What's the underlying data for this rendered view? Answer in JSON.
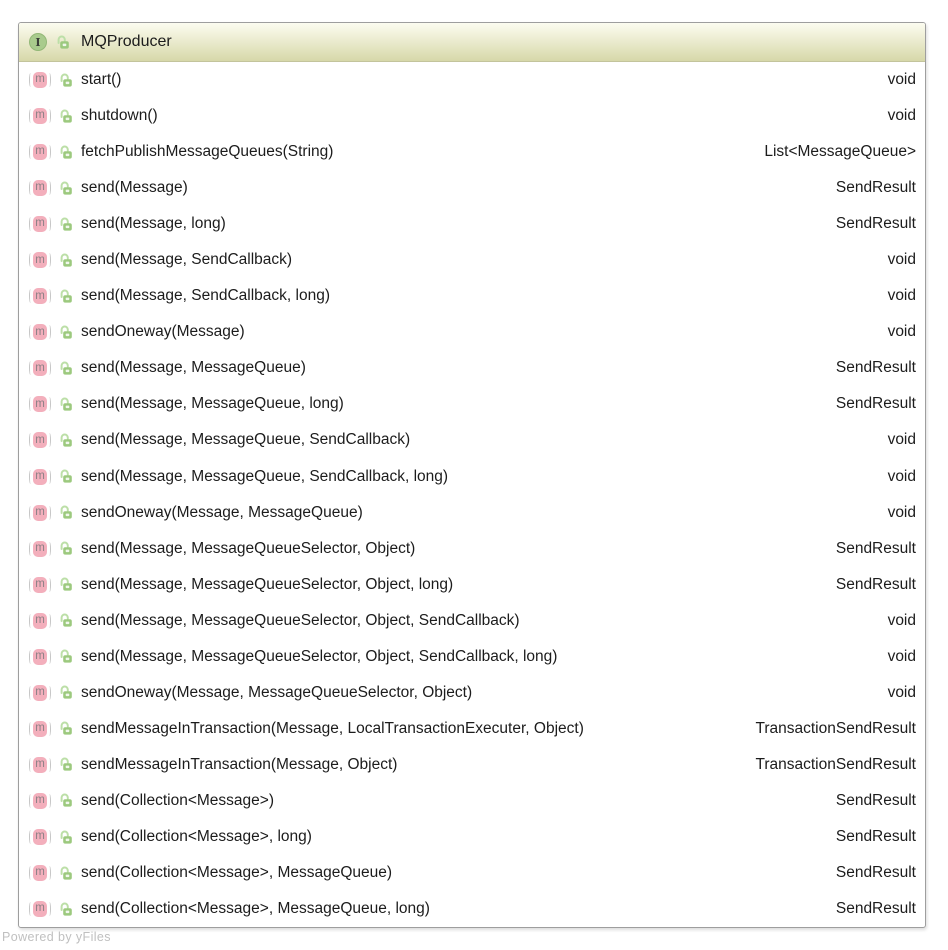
{
  "diagram": {
    "title": "MQProducer",
    "interface_icon_letter": "I",
    "method_icon_letter": "m",
    "methods": [
      {
        "name": "start()",
        "return": "void"
      },
      {
        "name": "shutdown()",
        "return": "void"
      },
      {
        "name": "fetchPublishMessageQueues(String)",
        "return": "List<MessageQueue>"
      },
      {
        "name": "send(Message)",
        "return": "SendResult"
      },
      {
        "name": "send(Message, long)",
        "return": "SendResult"
      },
      {
        "name": "send(Message, SendCallback)",
        "return": "void"
      },
      {
        "name": "send(Message, SendCallback, long)",
        "return": "void"
      },
      {
        "name": "sendOneway(Message)",
        "return": "void"
      },
      {
        "name": "send(Message, MessageQueue)",
        "return": "SendResult"
      },
      {
        "name": "send(Message, MessageQueue, long)",
        "return": "SendResult"
      },
      {
        "name": "send(Message, MessageQueue, SendCallback)",
        "return": "void"
      },
      {
        "name": "send(Message, MessageQueue, SendCallback, long)",
        "return": "void"
      },
      {
        "name": "sendOneway(Message, MessageQueue)",
        "return": "void"
      },
      {
        "name": "send(Message, MessageQueueSelector, Object)",
        "return": "SendResult"
      },
      {
        "name": "send(Message, MessageQueueSelector, Object, long)",
        "return": "SendResult"
      },
      {
        "name": "send(Message, MessageQueueSelector, Object, SendCallback)",
        "return": "void"
      },
      {
        "name": "send(Message, MessageQueueSelector, Object, SendCallback, long)",
        "return": "void"
      },
      {
        "name": "sendOneway(Message, MessageQueueSelector, Object)",
        "return": "void"
      },
      {
        "name": "sendMessageInTransaction(Message, LocalTransactionExecuter, Object)",
        "return": "TransactionSendResult"
      },
      {
        "name": "sendMessageInTransaction(Message, Object)",
        "return": "TransactionSendResult"
      },
      {
        "name": "send(Collection<Message>)",
        "return": "SendResult"
      },
      {
        "name": "send(Collection<Message>, long)",
        "return": "SendResult"
      },
      {
        "name": "send(Collection<Message>, MessageQueue)",
        "return": "SendResult"
      },
      {
        "name": "send(Collection<Message>, MessageQueue, long)",
        "return": "SendResult"
      }
    ]
  },
  "footer": {
    "watermark": "Powered by yFiles"
  },
  "colors": {
    "header_gradient_top": "#fcfcf0",
    "header_gradient_bottom": "#d7d8a9",
    "box_border": "#9e9e9e",
    "method_icon_fill": "#f3afbc",
    "lock_icon_fill": "#9cc97e",
    "lock_shackle": "#bcdfa7",
    "interface_icon_fill": "#a9cb8d",
    "text": "#1c1c1c",
    "watermark_text": "#c0c0c0"
  }
}
